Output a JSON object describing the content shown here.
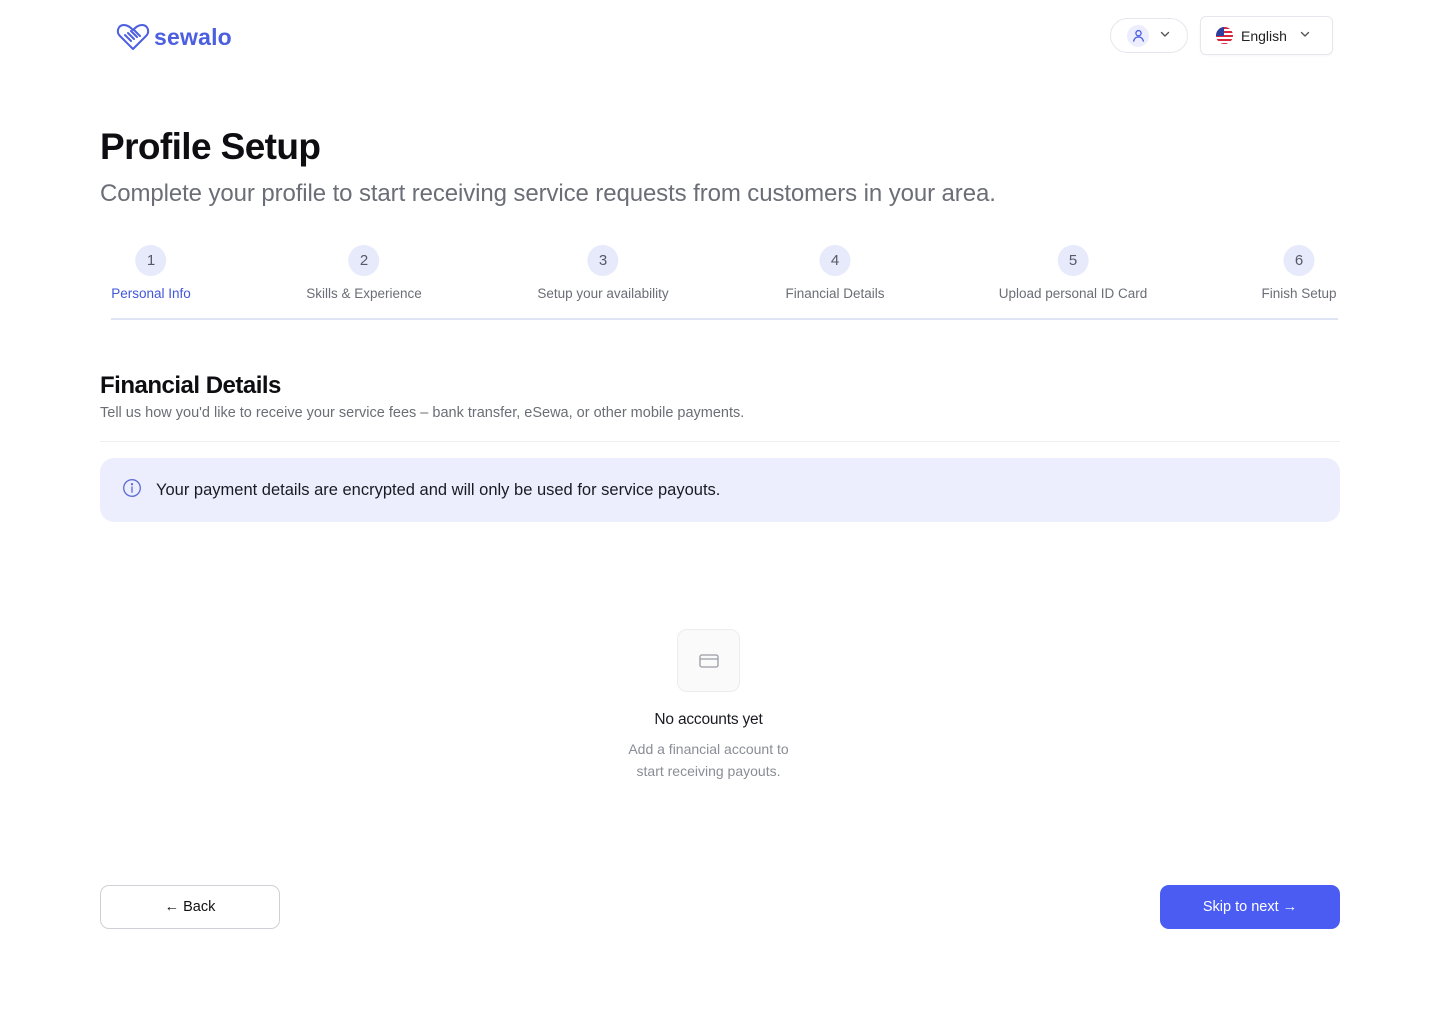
{
  "brand": {
    "name": "sewalo",
    "color": "#4b5fe0"
  },
  "header": {
    "user_menu": {
      "icon": "user-icon",
      "chevron": "chevron-down-icon"
    },
    "language": {
      "label": "English",
      "flag": "us-flag-icon"
    }
  },
  "page": {
    "title": "Profile Setup",
    "subtitle": "Complete your profile to start receiving service requests from customers in your area."
  },
  "stepper": {
    "steps": [
      {
        "number": "1",
        "label": "Personal Info",
        "active": true
      },
      {
        "number": "2",
        "label": "Skills & Experience",
        "active": false
      },
      {
        "number": "3",
        "label": "Setup your availability",
        "active": false
      },
      {
        "number": "4",
        "label": "Financial Details",
        "active": false
      },
      {
        "number": "5",
        "label": "Upload personal ID Card",
        "active": false
      },
      {
        "number": "6",
        "label": "Finish Setup",
        "active": false
      }
    ],
    "active_color": "#4257d8"
  },
  "section": {
    "title": "Financial Details",
    "description": "Tell us how you'd like to receive your service fees – bank transfer, eSewa, or other mobile payments."
  },
  "notice": {
    "icon": "info-icon",
    "text": "Your payment details are encrypted and will only be used for service payouts."
  },
  "empty_state": {
    "icon": "credit-card-icon",
    "title": "No accounts yet",
    "description": "Add a financial account to start receiving payouts."
  },
  "actions": {
    "back_label": "← Back",
    "next_label": "Skip to next →",
    "primary_color": "#4a5cf2"
  }
}
